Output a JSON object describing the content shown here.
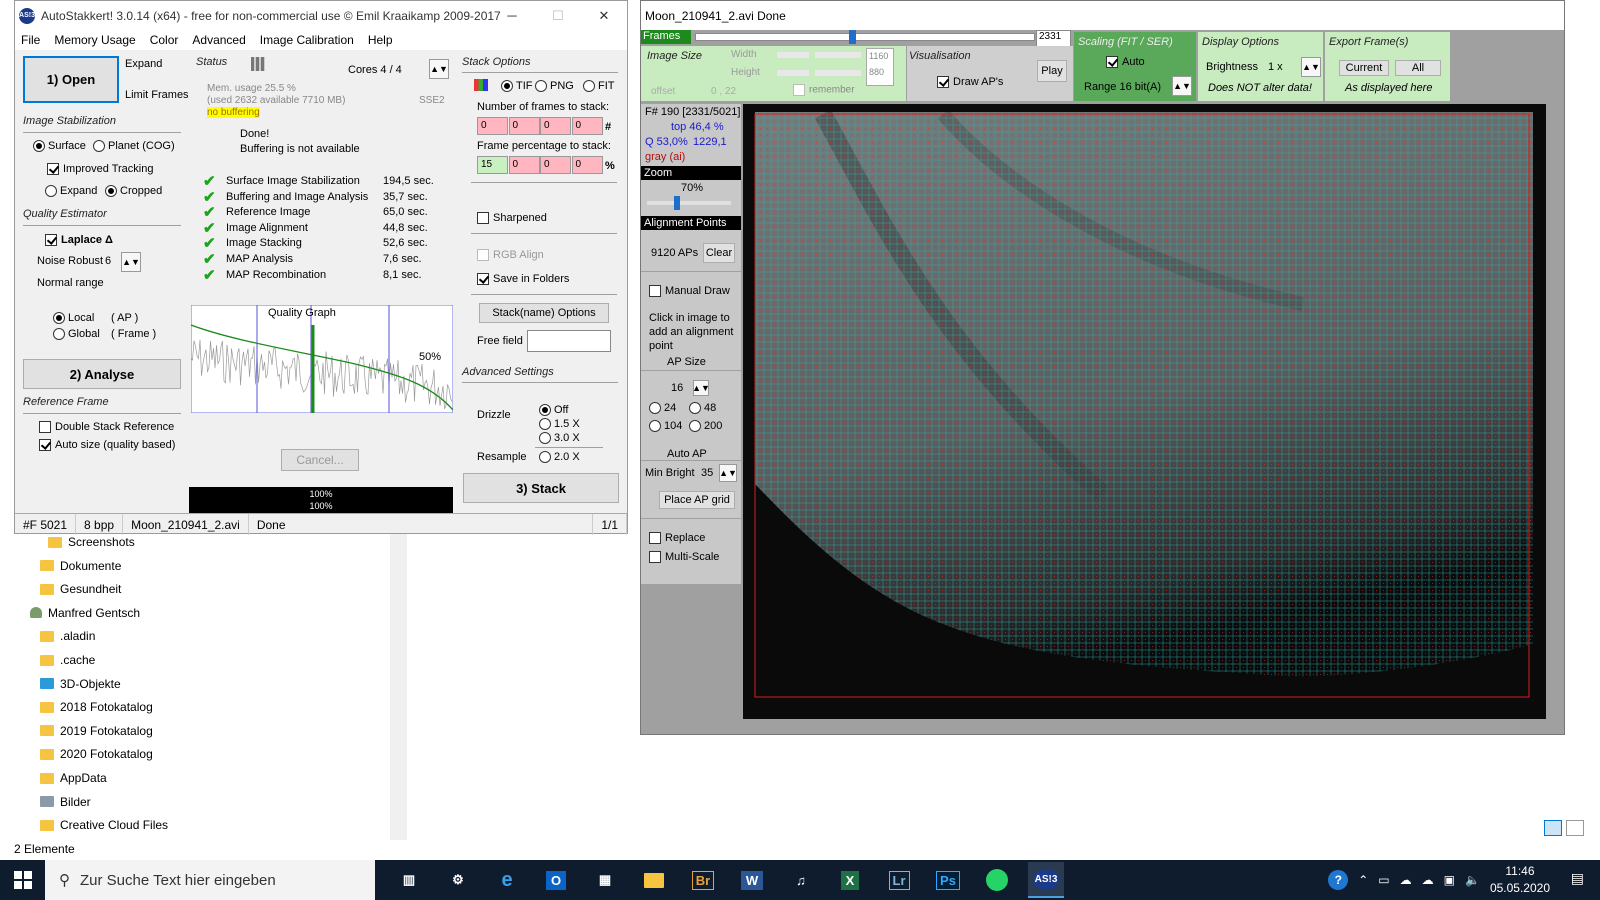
{
  "main_window": {
    "title": "AutoStakkert! 3.0.14 (x64) - free for non-commercial use © Emil Kraaikamp 2009-2017",
    "app_icon": "AS!3",
    "menu": [
      "File",
      "Memory Usage",
      "Color",
      "Advanced",
      "Image Calibration",
      "Help"
    ],
    "open_label": "1) Open",
    "expand_label": "Expand",
    "limit_frames_label": "Limit Frames",
    "image_stabilization": {
      "heading": "Image Stabilization",
      "surface": "Surface",
      "planet": "Planet (COG)",
      "improved_tracking": "Improved Tracking",
      "expand": "Expand",
      "cropped": "Cropped"
    },
    "quality_estimator": {
      "heading": "Quality Estimator",
      "laplace": "Laplace Δ",
      "noise_robust": "Noise Robust",
      "noise_value": "6",
      "normal_range": "Normal range",
      "local": "Local",
      "local_suffix": "( AP )",
      "global": "Global",
      "global_suffix": "( Frame )"
    },
    "analyse_label": "2) Analyse",
    "reference_frame": {
      "heading": "Reference Frame",
      "double_stack": "Double Stack Reference",
      "auto_size": "Auto size (quality based)"
    },
    "status": {
      "heading": "Status",
      "cores": "Cores 4 / 4",
      "mem_usage": "Mem. usage 25.5 %",
      "mem_detail": "(used 2632 available 7710 MB)",
      "sse": "SSE2",
      "buffering_badge": "no buffering",
      "done": "Done!",
      "buffering_msg": "Buffering is not available",
      "tasks": [
        {
          "name": "Surface Image Stabilization",
          "time": "194,5 sec."
        },
        {
          "name": "Buffering and Image Analysis",
          "time": "35,7 sec."
        },
        {
          "name": "Reference Image",
          "time": "65,0 sec."
        },
        {
          "name": "Image Alignment",
          "time": "44,8 sec."
        },
        {
          "name": "Image Stacking",
          "time": "52,6 sec."
        },
        {
          "name": "MAP Analysis",
          "time": "7,6 sec."
        },
        {
          "name": "MAP Recombination",
          "time": "8,1 sec."
        }
      ],
      "graph_title": "Quality Graph",
      "graph_pct": "50%",
      "cancel": "Cancel...",
      "progress1": "100%",
      "progress2": "100%"
    },
    "stack_options": {
      "heading": "Stack Options",
      "tif": "TIF",
      "png": "PNG",
      "fit": "FIT",
      "frames_label": "Number of frames to stack:",
      "frames": [
        "0",
        "0",
        "0",
        "0"
      ],
      "frames_suffix": "#",
      "pct_label": "Frame percentage to stack:",
      "pct": [
        "15",
        "0",
        "0",
        "0"
      ],
      "pct_suffix": "%",
      "sharpened": "Sharpened",
      "rgb_align": "RGB Align",
      "save_folders": "Save in Folders",
      "stackname_btn": "Stack(name) Options",
      "free_field": "Free field",
      "free_field_value": ""
    },
    "advanced": {
      "heading": "Advanced Settings",
      "drizzle": "Drizzle",
      "off": "Off",
      "x15": "1.5 X",
      "x30": "3.0 X",
      "resample": "Resample",
      "x20": "2.0 X"
    },
    "stack_label": "3) Stack",
    "statusbar": [
      "#F 5021",
      "8 bpp",
      "Moon_210941_2.avi",
      "Done",
      "1/1"
    ]
  },
  "viewer": {
    "title": "Moon_210941_2.avi   Done",
    "frames_label": "Frames",
    "frame_value": "2331",
    "frame_slider": 0.46,
    "image_size": {
      "heading": "Image Size",
      "width_label": "Width",
      "height_label": "Height",
      "width": "1160",
      "height": "880",
      "offset": "offset",
      "offset_val": "0 , 22",
      "remember": "remember"
    },
    "visualisation": {
      "heading": "Visualisation",
      "draw_aps": "Draw AP's",
      "play": "Play"
    },
    "scaling": {
      "heading": "Scaling (FIT / SER)",
      "auto": "Auto",
      "range": "Range 16 bit(A)"
    },
    "display": {
      "heading": "Display Options",
      "brightness": "Brightness",
      "brightness_val": "1 x",
      "note": "Does NOT alter data!"
    },
    "export": {
      "heading": "Export Frame(s)",
      "current": "Current",
      "all": "All",
      "note": "As displayed here"
    },
    "info": {
      "frame": "F# 190 [2331/5021]",
      "top": "top 46,4 %",
      "q": "Q 53,0%",
      "q_val": "1229,1",
      "gray": "gray (ai)"
    },
    "zoom": {
      "heading": "Zoom",
      "value": "70%",
      "level": 0.35
    },
    "ap": {
      "heading": "Alignment Points",
      "count": "9120 APs",
      "clear": "Clear",
      "manual_draw": "Manual Draw",
      "hint": "Click in image to add an alignment point",
      "size_heading": "AP Size",
      "size": "16",
      "s24": "24",
      "s48": "48",
      "s104": "104",
      "s200": "200",
      "auto_ap": "Auto AP",
      "min_bright": "Min Bright",
      "min_bright_val": "35",
      "place_grid": "Place AP grid",
      "replace": "Replace",
      "multiscale": "Multi-Scale"
    }
  },
  "explorer": {
    "items": [
      {
        "label": "Screenshots",
        "icon": "folder-icon"
      },
      {
        "label": "Dokumente",
        "icon": "folder-icon"
      },
      {
        "label": "Gesundheit",
        "icon": "folder-icon"
      },
      {
        "label": "Manfred Gentsch",
        "icon": "user-icon"
      },
      {
        "label": ".aladin",
        "icon": "folder-icon"
      },
      {
        "label": ".cache",
        "icon": "folder-icon"
      },
      {
        "label": "3D-Objekte",
        "icon": "3d-objects-icon"
      },
      {
        "label": "2018 Fotokatalog",
        "icon": "folder-icon"
      },
      {
        "label": "2019 Fotokatalog",
        "icon": "folder-icon"
      },
      {
        "label": "2020 Fotokatalog",
        "icon": "folder-icon"
      },
      {
        "label": "AppData",
        "icon": "folder-icon"
      },
      {
        "label": "Bilder",
        "icon": "pictures-icon"
      },
      {
        "label": "Creative Cloud Files",
        "icon": "folder-icon"
      }
    ],
    "count": "2 Elemente"
  },
  "taskbar": {
    "search_placeholder": "Zur Suche Text hier eingeben",
    "apps": [
      "Br",
      "Lr",
      "Ps",
      "AS!3"
    ],
    "time": "11:46",
    "date": "05.05.2020"
  },
  "colors": {
    "accent": "#0078d7",
    "ap_box": "#2fb0b0",
    "ap_dot": "#e03030",
    "green": "#c8ecc0"
  }
}
